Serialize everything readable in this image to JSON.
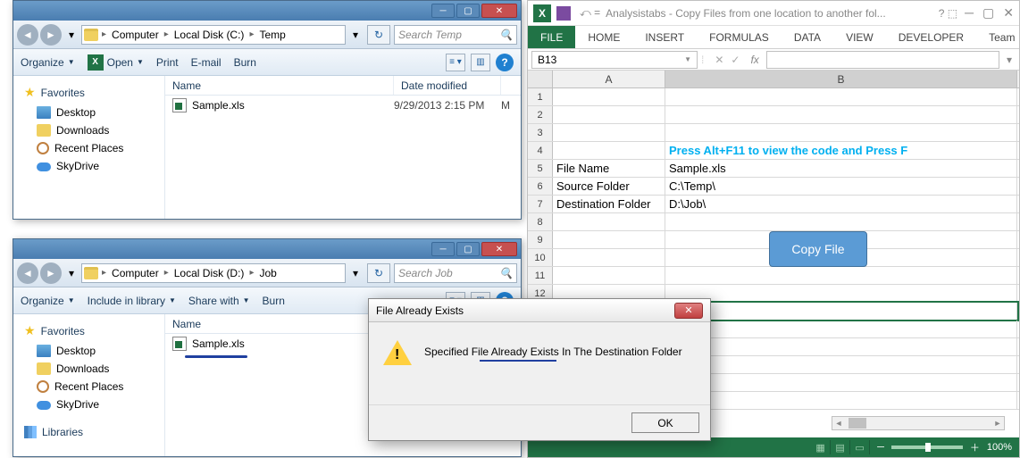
{
  "explorer1": {
    "breadcrumb": [
      "Computer",
      "Local Disk (C:)",
      "Temp"
    ],
    "search_placeholder": "Search Temp",
    "toolbar": {
      "organize": "Organize",
      "open": "Open",
      "print": "Print",
      "email": "E-mail",
      "burn": "Burn"
    },
    "favorites_header": "Favorites",
    "favorites": [
      "Desktop",
      "Downloads",
      "Recent Places",
      "SkyDrive"
    ],
    "columns": {
      "name": "Name",
      "date": "Date modified"
    },
    "file": {
      "name": "Sample.xls",
      "date": "9/29/2013 2:15 PM",
      "extra": "M"
    }
  },
  "explorer2": {
    "breadcrumb": [
      "Computer",
      "Local Disk (D:)",
      "Job"
    ],
    "search_placeholder": "Search Job",
    "toolbar": {
      "organize": "Organize",
      "include": "Include in library",
      "share": "Share with",
      "burn": "Burn"
    },
    "favorites_header": "Favorites",
    "favorites": [
      "Desktop",
      "Downloads",
      "Recent Places",
      "SkyDrive"
    ],
    "libraries_header": "Libraries",
    "columns": {
      "name": "Name"
    },
    "file": {
      "name": "Sample.xls"
    }
  },
  "excel": {
    "title": "Analysistabs - Copy Files from one location to another fol...",
    "tabs": [
      "FILE",
      "HOME",
      "INSERT",
      "FORMULAS",
      "DATA",
      "VIEW",
      "DEVELOPER",
      "Team"
    ],
    "namebox": "B13",
    "fx_label": "fx",
    "col_a": "A",
    "col_b": "B",
    "instruction": "Press Alt+F11 to view the code and Press F",
    "rows": {
      "r5a": "File Name",
      "r5b": "Sample.xls",
      "r6a": "Source Folder",
      "r6b": "C:\\Temp\\",
      "r7a": "Destination Folder",
      "r7b": "D:\\Job\\"
    },
    "button": "Copy File",
    "zoom": "100%"
  },
  "dialog": {
    "title": "File Already Exists",
    "message": "Specified File Already Exists In The Destination Folder",
    "ok": "OK"
  }
}
